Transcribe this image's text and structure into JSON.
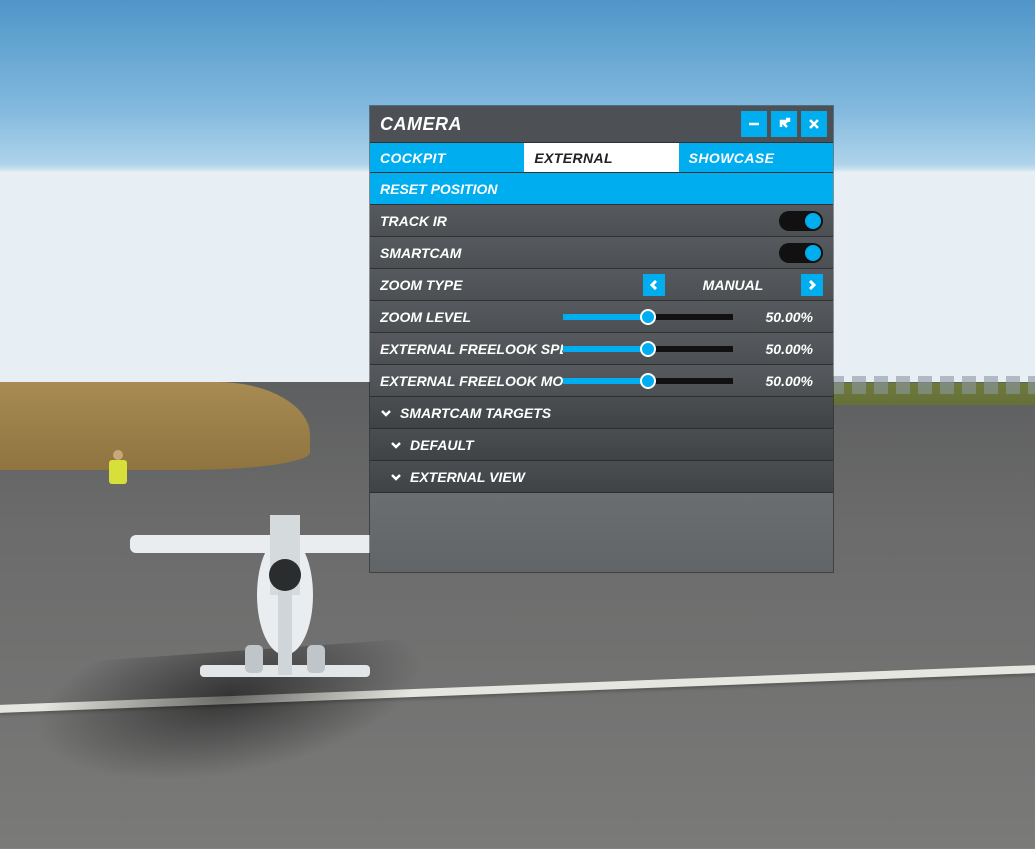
{
  "accent": "#00AEEF",
  "panel": {
    "title": "CAMERA",
    "window_buttons": {
      "minimize_name": "minimize-icon",
      "popout_name": "popout-icon",
      "close_name": "close-icon"
    },
    "tabs": [
      {
        "label": "COCKPIT",
        "active": false
      },
      {
        "label": "EXTERNAL",
        "active": true
      },
      {
        "label": "SHOWCASE",
        "active": false
      }
    ],
    "reset_label": "RESET POSITION",
    "toggles": [
      {
        "label": "TRACK IR",
        "on": true
      },
      {
        "label": "SMARTCAM",
        "on": true
      }
    ],
    "stepper": {
      "label": "ZOOM TYPE",
      "value": "MANUAL"
    },
    "sliders": [
      {
        "label": "ZOOM LEVEL",
        "percent": 50,
        "display": "50.00%"
      },
      {
        "label": "EXTERNAL FREELOOK SPEED",
        "percent": 50,
        "display": "50.00%"
      },
      {
        "label": "EXTERNAL FREELOOK MOMENT",
        "percent": 50,
        "display": "50.00%"
      }
    ],
    "sections": [
      {
        "label": "SMARTCAM TARGETS",
        "indent": false
      },
      {
        "label": "DEFAULT",
        "indent": true
      },
      {
        "label": "EXTERNAL VIEW",
        "indent": true
      }
    ]
  }
}
